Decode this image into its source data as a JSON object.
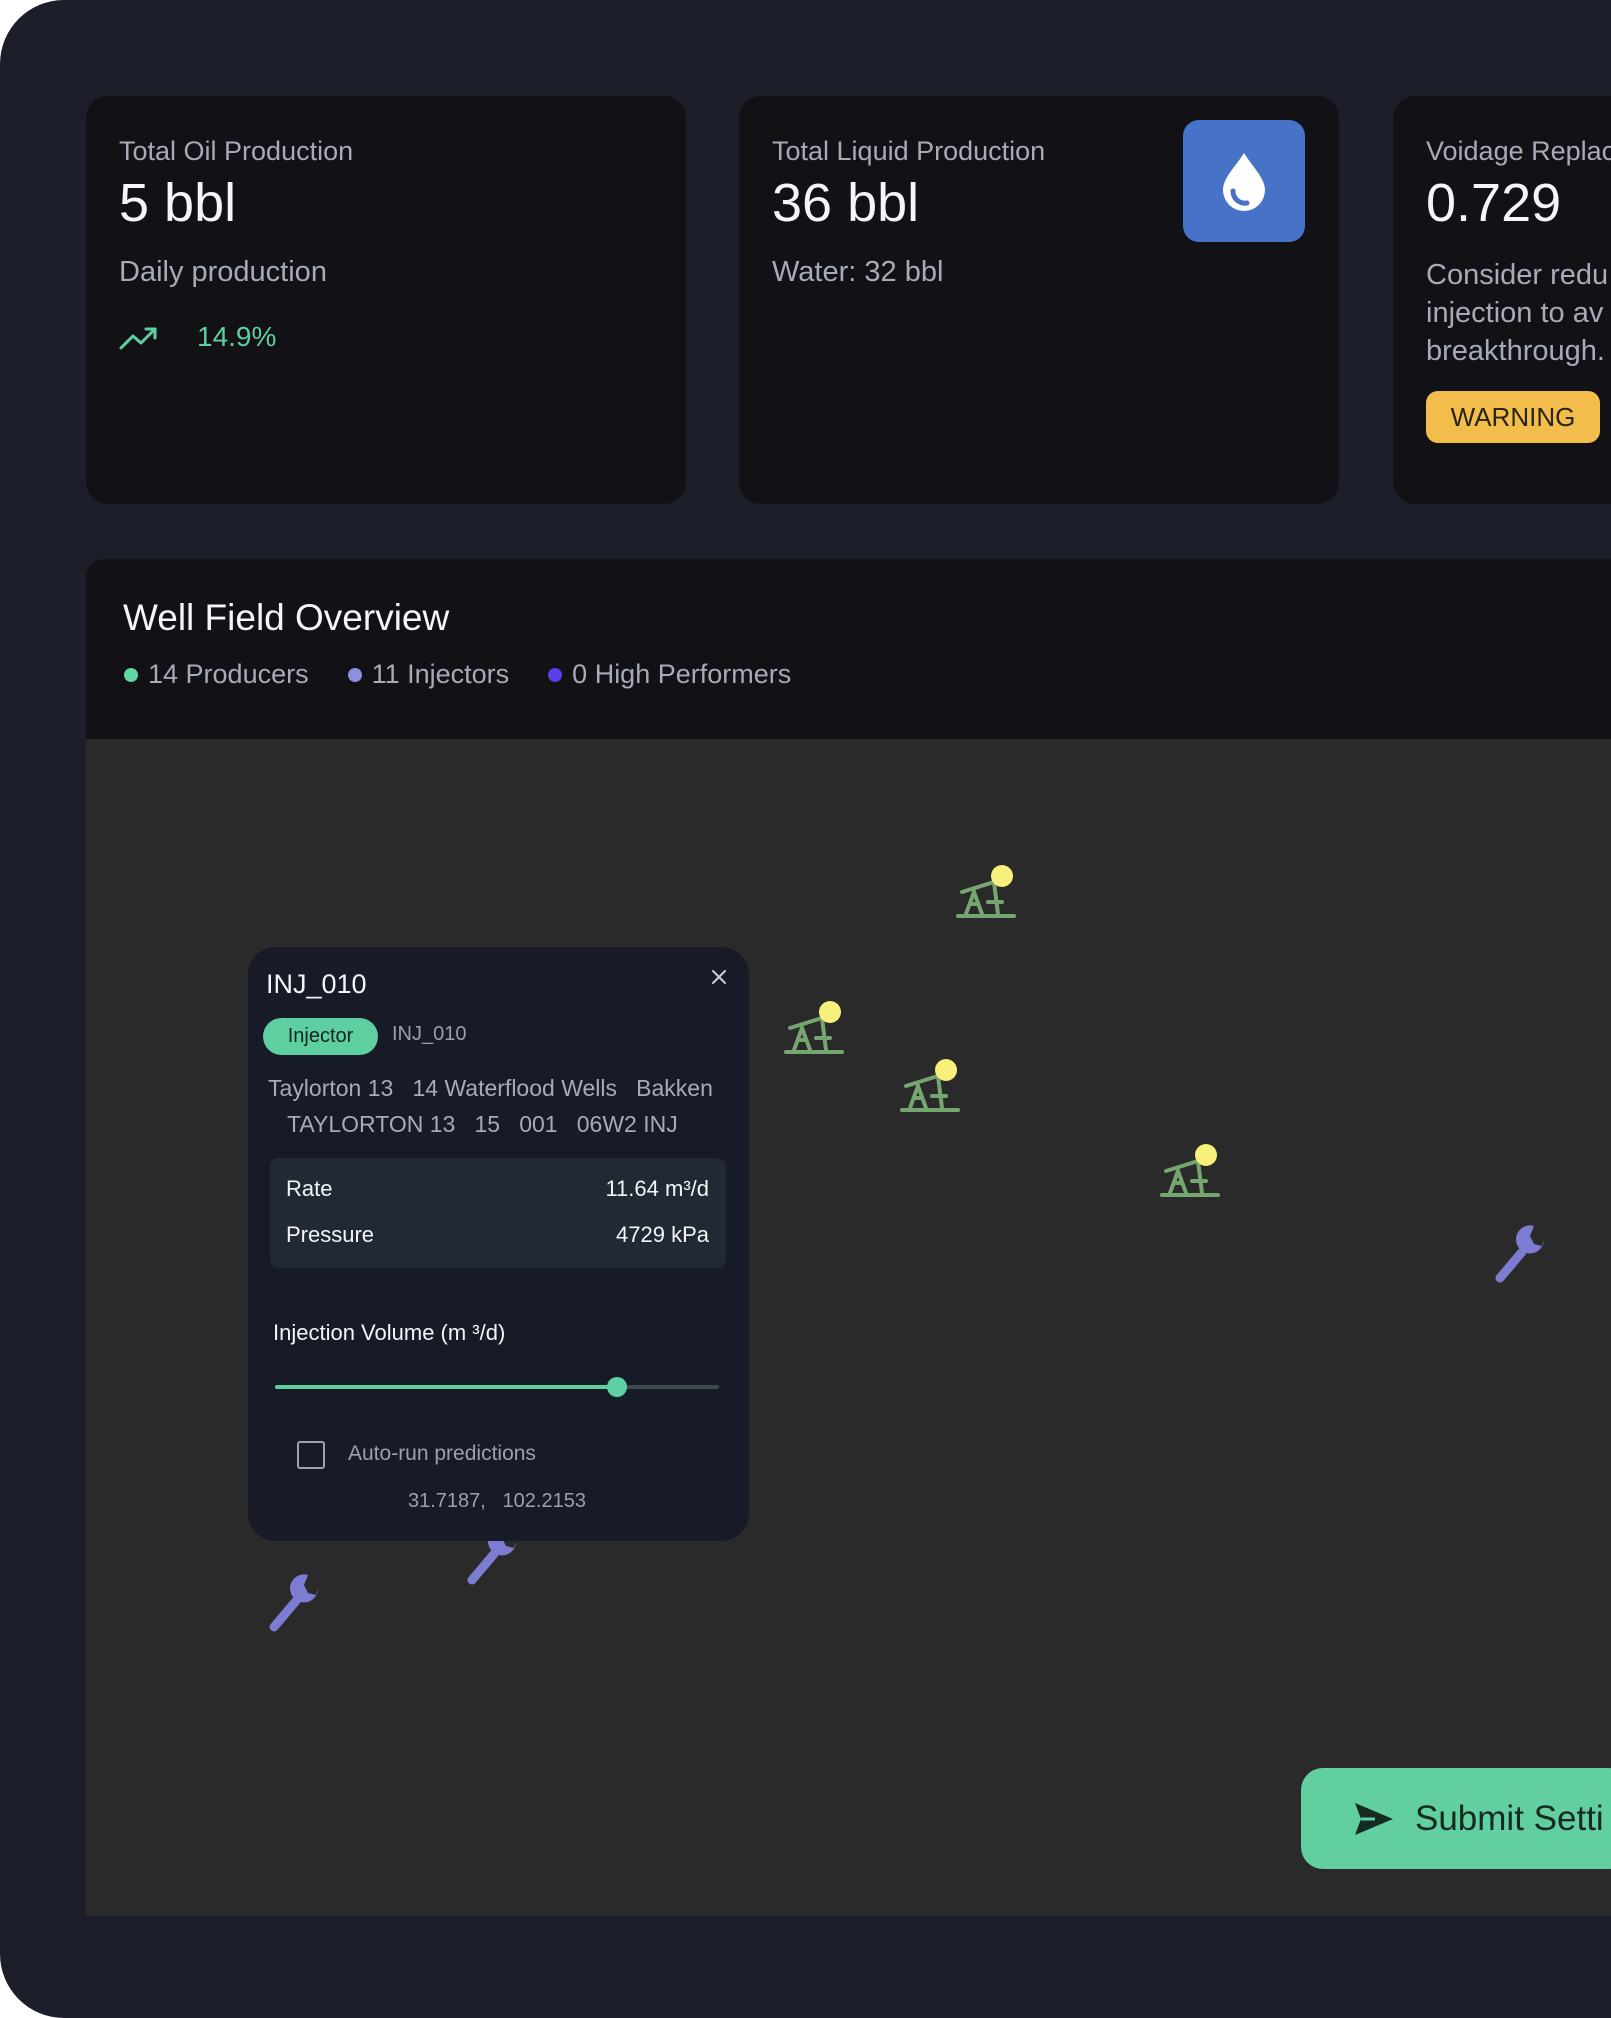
{
  "cards": {
    "oil": {
      "title": "Total Oil Production",
      "value": "5 bbl",
      "subtitle": "Daily production",
      "trend_percent": "14.9%",
      "trend_icon": "trending-up-icon"
    },
    "liquid": {
      "title": "Total Liquid Production",
      "value": "36 bbl",
      "subtitle": "Water: 32 bbl",
      "icon": "water-drop-icon"
    },
    "voidage": {
      "title": "Voidage Replac",
      "value": "0.729",
      "message_lines": [
        "Consider redu",
        "injection to av",
        "breakthrough."
      ],
      "badge": "WARNING"
    }
  },
  "panel": {
    "title": "Well Field Overview",
    "legend": [
      {
        "label": "14 Producers",
        "color": "#62d7a4"
      },
      {
        "label": "11 Injectors",
        "color": "#8f8fe0"
      },
      {
        "label": "0 High Performers",
        "color": "#5b3ee8"
      }
    ]
  },
  "map": {
    "producer_icon": "pumpjack-icon",
    "injector_icon": "wrench-icon",
    "producer_color": "#76a670",
    "producer_dot_color": "#f7f07a",
    "injector_color": "#7c7cd2"
  },
  "popup": {
    "title": "INJ_010",
    "type_badge": "Injector",
    "id_label": "INJ_010",
    "location_line1": "Taylorton 13   14 Waterflood Wells   Bakken",
    "location_line2": "TAYLORTON 13   15   001   06W2 INJ",
    "stats": [
      {
        "label": "Rate",
        "value": "11.64 m³/d"
      },
      {
        "label": "Pressure",
        "value": "4729 kPa"
      }
    ],
    "slider_label": "Injection Volume (m  ³/d)",
    "slider_fraction": 0.77,
    "checkbox_label": "Auto-run predictions",
    "checkbox_checked": false,
    "coords": "31.7187,   102.2153"
  },
  "submit_label": "Submit Setti",
  "colors": {
    "background": "#1c1f2a",
    "card": "#111116",
    "accent": "#5ecfa0",
    "warning": "#f2bd4b",
    "drop_box": "#4672c8"
  }
}
